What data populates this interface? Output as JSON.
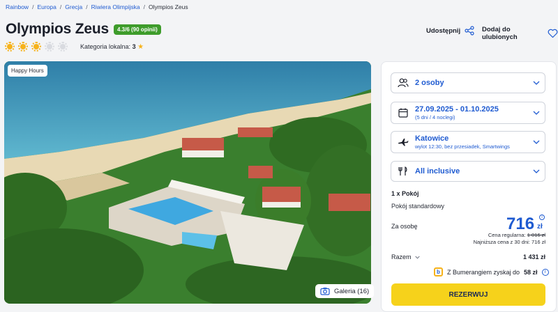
{
  "breadcrumb": [
    "Rainbow",
    "Europa",
    "Grecja",
    "Riwiera Olimpijska",
    "Olympios Zeus"
  ],
  "title": "Olympios Zeus",
  "rating_badge": "4.3/6 (90 opinii)",
  "suns": {
    "filled": 3,
    "total": 5
  },
  "local_category": {
    "label": "Kategoria lokalna:",
    "value": "3"
  },
  "share_label": "Udostępnij",
  "favorite_label": "Dodaj do ulubionych",
  "photo_badge": "Happy Hours",
  "gallery_label": "Galeria (16)",
  "selectors": {
    "persons": {
      "main": "2 osoby"
    },
    "dates": {
      "main": "27.09.2025 - 01.10.2025",
      "sub": "(5 dni / 4 noclegi)"
    },
    "flight": {
      "main": "Katowice",
      "sub": "wylot 12:30, bez przesiadek, Smartwings"
    },
    "board": {
      "main": "All inclusive"
    }
  },
  "room": {
    "count": "1 x Pokój",
    "type": "Pokój standardowy"
  },
  "price": {
    "per_person_label": "Za osobę",
    "value": "716",
    "currency": "zł",
    "regular_label": "Cena regularna:",
    "regular_value": "1 016 zł",
    "lowest": "Najniższa cena z 30 dni: 716 zł",
    "total_label": "Razem",
    "total_value": "1 431 zł"
  },
  "bumerang": {
    "text": "Z Bumerangiem zyskaj do",
    "value": "58 zł",
    "logo": "b"
  },
  "reserve_label": "REZERWUJ",
  "colors": {
    "accent": "#1f5bd1",
    "button": "#f6d21b",
    "rating": "#3e9c2b",
    "sun": "#f6b21b"
  }
}
